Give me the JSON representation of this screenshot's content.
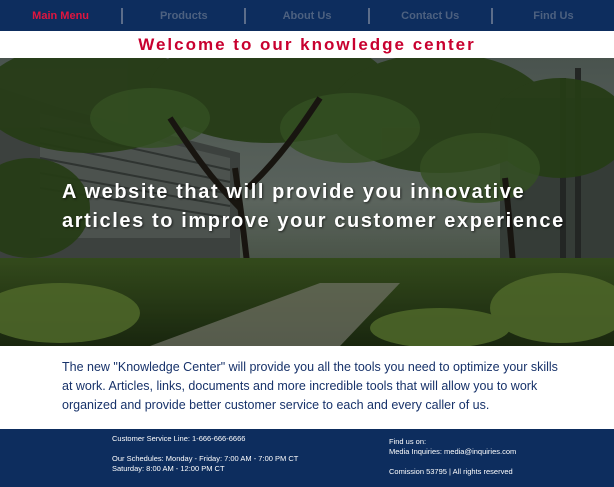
{
  "nav": {
    "items": [
      {
        "label": "Main Menu",
        "active": true
      },
      {
        "label": "Products",
        "active": false
      },
      {
        "label": "About Us",
        "active": false
      },
      {
        "label": "Contact Us",
        "active": false
      },
      {
        "label": "Find Us",
        "active": false
      }
    ]
  },
  "welcome": "Welcome to our knowledge center",
  "hero": {
    "headline": "A website that will provide you innovative articles to improve your customer experience"
  },
  "intro": "The new \"Knowledge Center\" will provide you all the tools you need to optimize your skills at work. Articles, links, documents and more incredible tools that will allow you to work organized and provide better customer service to each and every caller of us.",
  "footer": {
    "service_line": "Customer Service Line: 1-666-666-6666",
    "schedule_weekdays": "Our Schedules: Monday - Friday: 7:00 AM - 7:00 PM CT",
    "schedule_saturday": "Saturday: 8:00 AM - 12:00 PM CT",
    "find_us": "Find us on:",
    "media": "Media Inquiries: media@inquiries.com",
    "rights": "Comission 53795 | All rights reserved"
  },
  "colors": {
    "nav_bg": "#0d2d5e",
    "active_nav": "#e0153f",
    "welcome_red": "#c8002f",
    "body_text": "#17326a"
  }
}
